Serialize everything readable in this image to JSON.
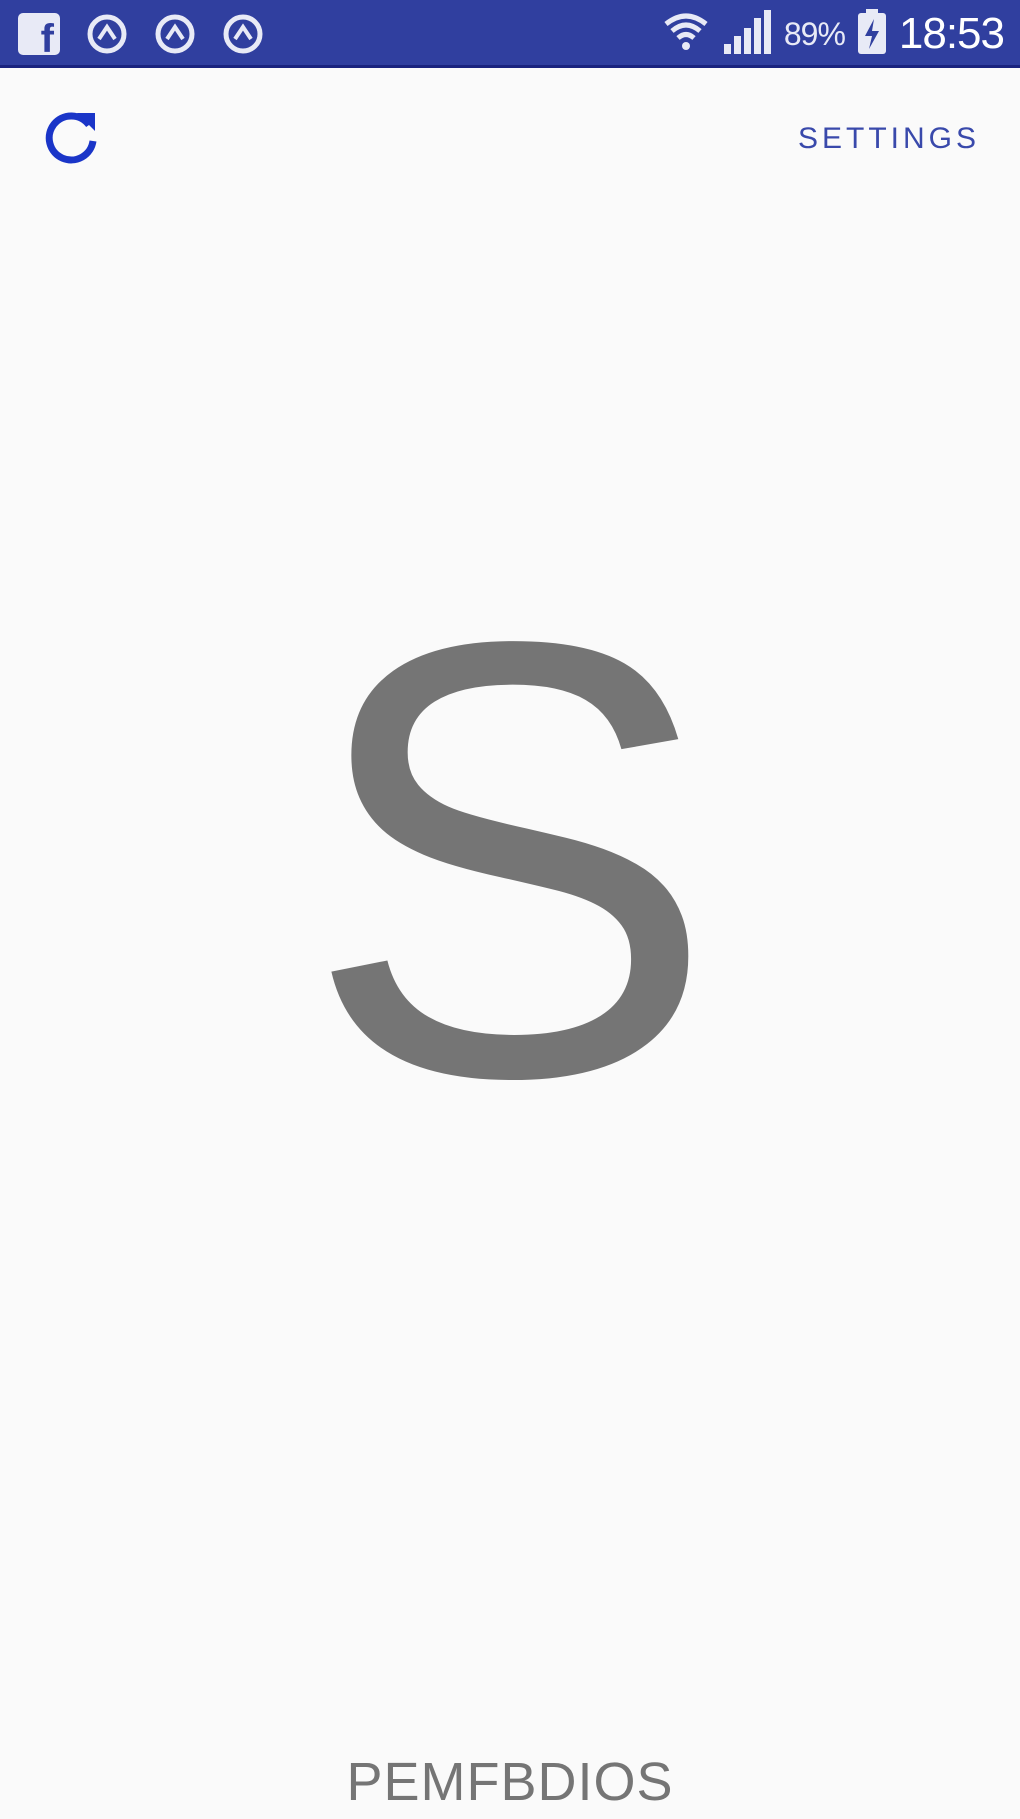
{
  "status_bar": {
    "facebook_icon": "facebook-icon",
    "notification_icons": [
      "notification-icon",
      "notification-icon",
      "notification-icon"
    ],
    "wifi_icon": "wifi-icon",
    "signal_icon": "signal-icon",
    "battery_percent": "89%",
    "battery_icon": "battery-icon",
    "time": "18:53",
    "background_color": "#303f9f"
  },
  "toolbar": {
    "refresh_icon": "refresh-icon",
    "settings_label": "SETTINGS",
    "accent_color": "#3949ab"
  },
  "main": {
    "letter": "S",
    "word": "PEMFBDIOS",
    "text_color": "#757575"
  }
}
